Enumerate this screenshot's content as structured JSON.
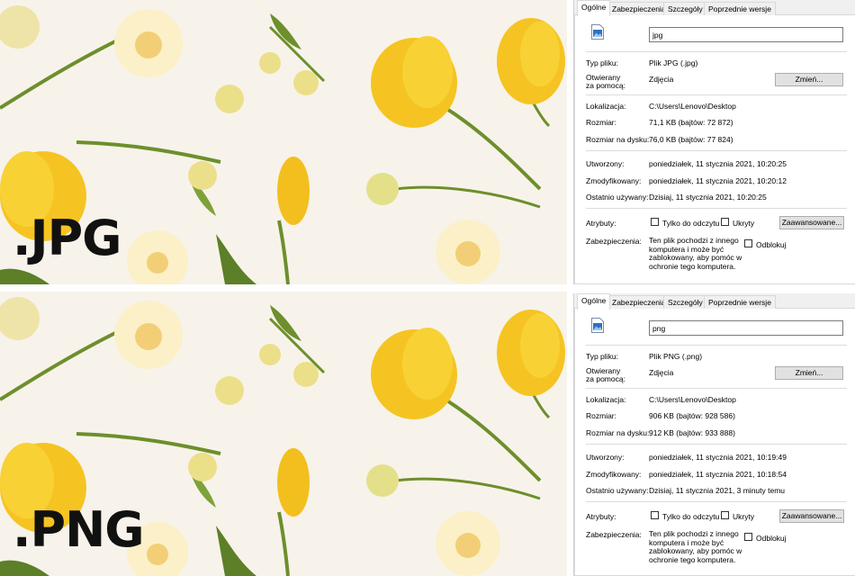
{
  "top": {
    "format_label": ".JPG",
    "tabs": [
      "Ogólne",
      "Zabezpieczenia",
      "Szczegóły",
      "Poprzednie wersje"
    ],
    "file_name": "jpg",
    "type_label": "Typ pliku:",
    "type_value": "Plik JPG (.jpg)",
    "opens_label_1": "Otwierany",
    "opens_label_2": "za pomocą:",
    "opens_value": "Zdjęcia",
    "change_button": "Zmień...",
    "location_label": "Lokalizacja:",
    "location_value": "C:\\Users\\Lenovo\\Desktop",
    "size_label": "Rozmiar:",
    "size_value": "71,1 KB (bajtów: 72 872)",
    "disk_size_label": "Rozmiar na dysku:",
    "disk_size_value": "76,0 KB (bajtów: 77 824)",
    "created_label": "Utworzony:",
    "created_value": "poniedziałek, 11 stycznia 2021, 10:20:25",
    "modified_label": "Zmodyfikowany:",
    "modified_value": "poniedziałek, 11 stycznia 2021, 10:20:12",
    "accessed_label": "Ostatnio używany:",
    "accessed_value": "Dzisiaj, 11 stycznia 2021, 10:20:25",
    "attributes_label": "Atrybuty:",
    "readonly_label": "Tylko do odczytu",
    "hidden_label": "Ukryty",
    "advanced_button": "Zaawansowane...",
    "security_label": "Zabezpieczenia:",
    "security_text": "Ten plik pochodzi z innego komputera i może być zablokowany, aby pomóc w ochronie tego komputera.",
    "unblock_label": "Odblokuj"
  },
  "bottom": {
    "format_label": ".PNG",
    "tabs": [
      "Ogólne",
      "Zabezpieczenia",
      "Szczegóły",
      "Poprzednie wersje"
    ],
    "file_name": "png",
    "type_label": "Typ pliku:",
    "type_value": "Plik PNG (.png)",
    "opens_label_1": "Otwierany",
    "opens_label_2": "za pomocą:",
    "opens_value": "Zdjęcia",
    "change_button": "Zmień...",
    "location_label": "Lokalizacja:",
    "location_value": "C:\\Users\\Lenovo\\Desktop",
    "size_label": "Rozmiar:",
    "size_value": "906 KB (bajtów: 928 586)",
    "disk_size_label": "Rozmiar na dysku:",
    "disk_size_value": "912 KB (bajtów: 933 888)",
    "created_label": "Utworzony:",
    "created_value": "poniedziałek, 11 stycznia 2021, 10:19:49",
    "modified_label": "Zmodyfikowany:",
    "modified_value": "poniedziałek, 11 stycznia 2021, 10:18:54",
    "accessed_label": "Ostatnio używany:",
    "accessed_value": "Dzisiaj, 11 stycznia 2021, 3 minuty temu",
    "attributes_label": "Atrybuty:",
    "readonly_label": "Tylko do odczytu",
    "hidden_label": "Ukryty",
    "advanced_button": "Zaawansowane...",
    "security_label": "Zabezpieczenia:",
    "security_text": "Ten plik pochodzi z innego komputera i może być zablokowany, aby pomóc w ochronie tego komputera.",
    "unblock_label": "Odblokuj"
  },
  "colors": {
    "photo_background": "#f7f3ea",
    "tulip_yellow": "#f5c422",
    "stem_green": "#6d8f2c",
    "narcissus_cream": "#fbf0c8",
    "dialog_background": "#f0f0f0"
  },
  "icons": {
    "file_icon": "image-file-icon"
  }
}
